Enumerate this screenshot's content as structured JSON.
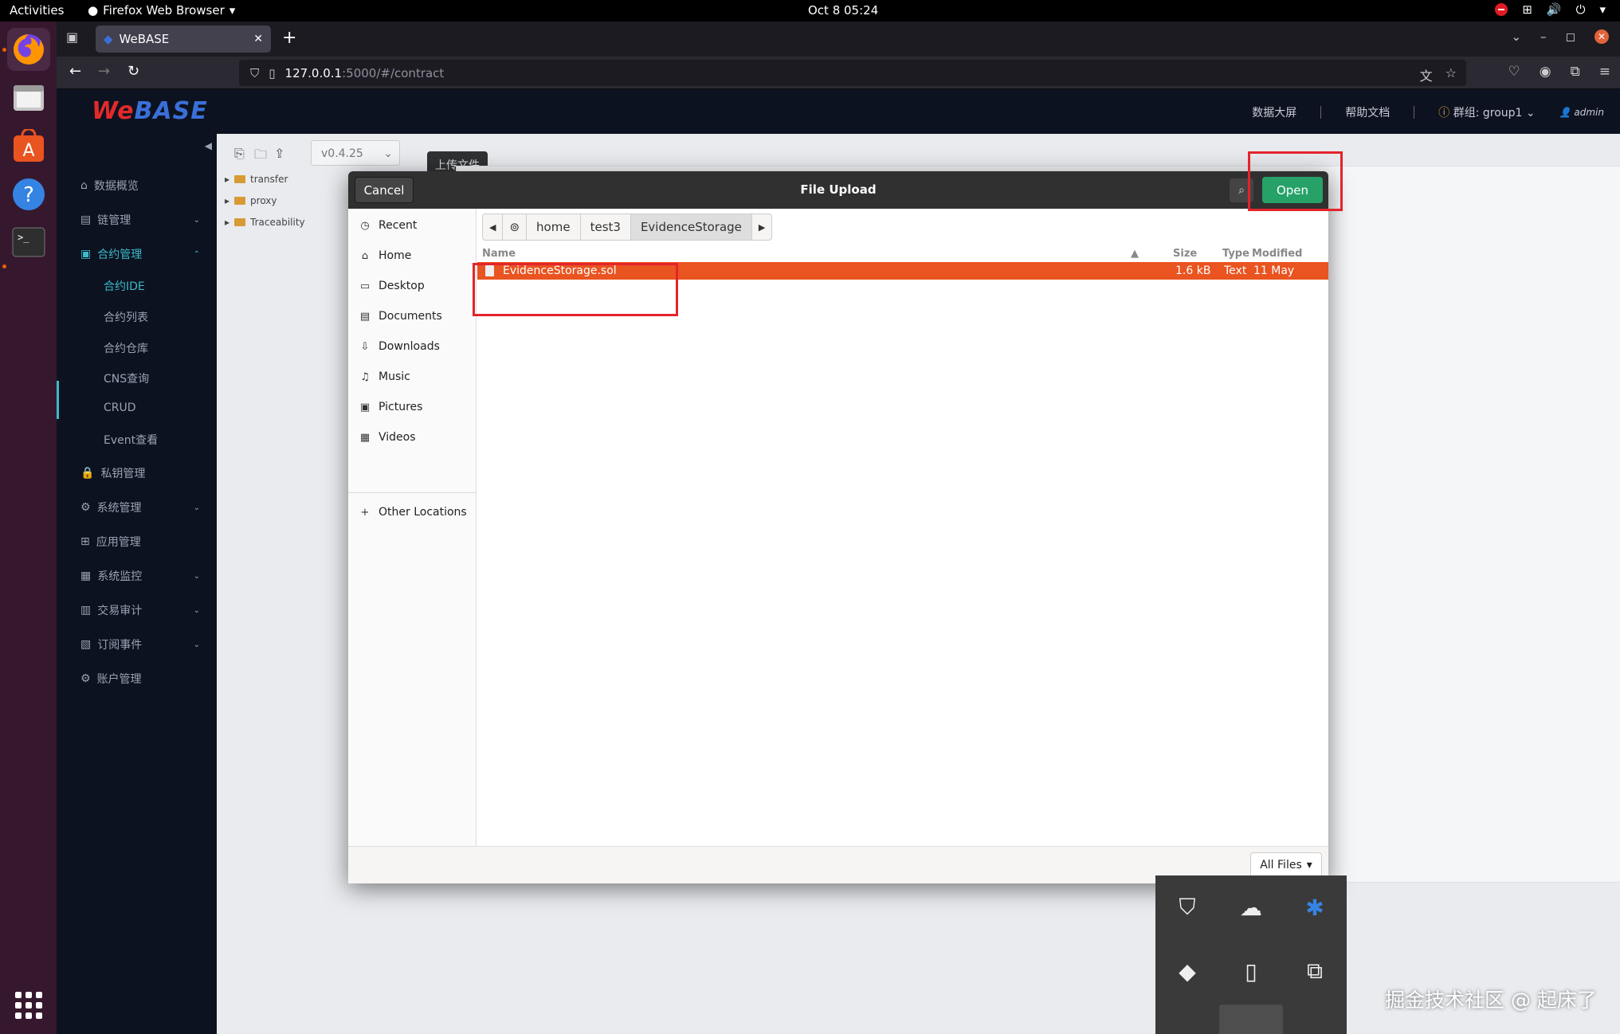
{
  "topbar": {
    "activities": "Activities",
    "app_menu": "Firefox Web Browser",
    "clock": "Oct 8  05:24"
  },
  "browser": {
    "tab_title": "WeBASE",
    "url_host": "127.0.0.1",
    "url_rest": ":5000/#/contract"
  },
  "webase": {
    "logo_we": "We",
    "logo_base": "BASE",
    "header_links": [
      "数据大屏",
      "帮助文档"
    ],
    "group": "群组: group1",
    "user": "admin",
    "sidebar": {
      "items": [
        {
          "label": "数据概览",
          "icon": "home-icon"
        },
        {
          "label": "链管理",
          "icon": "chain-icon"
        },
        {
          "label": "合约管理",
          "icon": "contract-icon"
        },
        {
          "label": "私钥管理",
          "icon": "lock-icon"
        },
        {
          "label": "系统管理",
          "icon": "settings-icon"
        },
        {
          "label": "应用管理",
          "icon": "grid-icon"
        },
        {
          "label": "系统监控",
          "icon": "monitor-icon"
        },
        {
          "label": "交易审计",
          "icon": "chart-icon"
        },
        {
          "label": "订阅事件",
          "icon": "event-icon"
        },
        {
          "label": "账户管理",
          "icon": "account-icon"
        }
      ],
      "sub_items": [
        "合约IDE",
        "合约列表",
        "合约仓库",
        "CNS查询",
        "CRUD",
        "Event查看"
      ]
    },
    "ide": {
      "version": "v0.4.25",
      "tooltip": "上传文件",
      "tree": [
        "transfer",
        "proxy",
        "Traceability"
      ]
    }
  },
  "dialog": {
    "cancel": "Cancel",
    "title": "File Upload",
    "open": "Open",
    "places": [
      "Recent",
      "Home",
      "Desktop",
      "Documents",
      "Downloads",
      "Music",
      "Pictures",
      "Videos"
    ],
    "other_locations": "Other Locations",
    "path": [
      "home",
      "test3",
      "EvidenceStorage"
    ],
    "columns": {
      "name": "Name",
      "size": "Size",
      "type": "Type",
      "modified": "Modified"
    },
    "files": [
      {
        "name": "EvidenceStorage.sol",
        "size": "1.6 kB",
        "type": "Text",
        "modified": "11 May"
      }
    ],
    "filter": "All Files"
  },
  "watermark": "掘金技术社区 @ 起床了",
  "colors": {
    "selection": "#e95420",
    "open_button": "#26a269",
    "highlight_box": "#e3242b",
    "sidebar_active": "#3db9c9"
  }
}
